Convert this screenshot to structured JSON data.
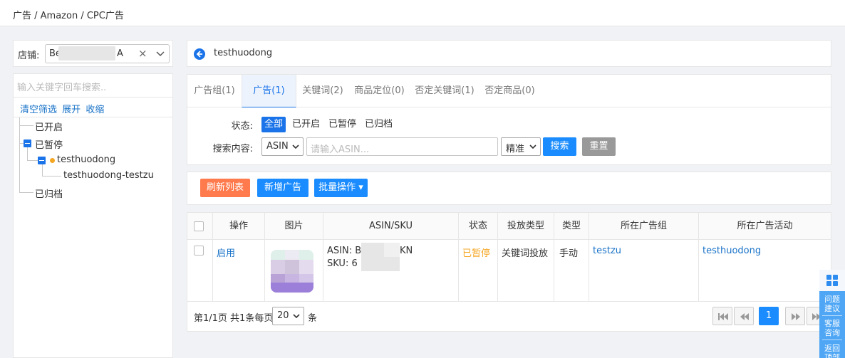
{
  "breadcrumb": "广告 / Amazon / CPC广告",
  "shop": {
    "label": "店铺:",
    "value_start": "Be",
    "value_end": "A"
  },
  "tree": {
    "search_placeholder": "输入关键字回车搜索..",
    "links": [
      "清空筛选",
      "展开",
      "收缩"
    ],
    "nodes": {
      "enabled": "已开启",
      "paused": "已暂停",
      "campaign": "testhuodong",
      "group": "testhuodong-testzu",
      "archived": "已归档"
    }
  },
  "header": {
    "title": "testhuodong"
  },
  "tabs": [
    "广告组(1)",
    "广告(1)",
    "关键词(2)",
    "商品定位(0)",
    "否定关键词(1)",
    "否定商品(0)"
  ],
  "active_tab": "广告(1)",
  "filters": {
    "status_label": "状态:",
    "status_options": [
      "全部",
      "已开启",
      "已暂停",
      "已归档"
    ],
    "status_selected": "全部",
    "search_label": "搜索内容:",
    "search_field": "ASIN",
    "search_placeholder": "请输入ASIN...",
    "match_mode": "精准",
    "search_button": "搜索",
    "reset_button": "重置"
  },
  "toolbar": {
    "refresh": "刷新列表",
    "add": "新增广告",
    "batch": "批量操作 ▾"
  },
  "table": {
    "headers": [
      "操作",
      "图片",
      "ASIN/SKU",
      "状态",
      "投放类型",
      "类型",
      "所在广告组",
      "所在广告活动"
    ],
    "rows": [
      {
        "action": "启用",
        "asin_label": "ASIN:",
        "asin_start": "B",
        "asin_end": "KN",
        "sku_label": "SKU:",
        "sku_start": "6",
        "status": "已暂停",
        "targeting": "关键词投放",
        "type": "手动",
        "ad_group": "testzu",
        "campaign": "testhuodong"
      }
    ]
  },
  "pager": {
    "summary": "第1/1页 共1条每页",
    "per_page": "20",
    "unit": "条",
    "current": "1"
  },
  "side": {
    "feedback": "问题建议",
    "service": "客服咨询",
    "top": "返回顶部"
  },
  "colors": {
    "accent": "#1a8cff",
    "paused": "#f5a623",
    "refresh": "#ff7a4d"
  }
}
